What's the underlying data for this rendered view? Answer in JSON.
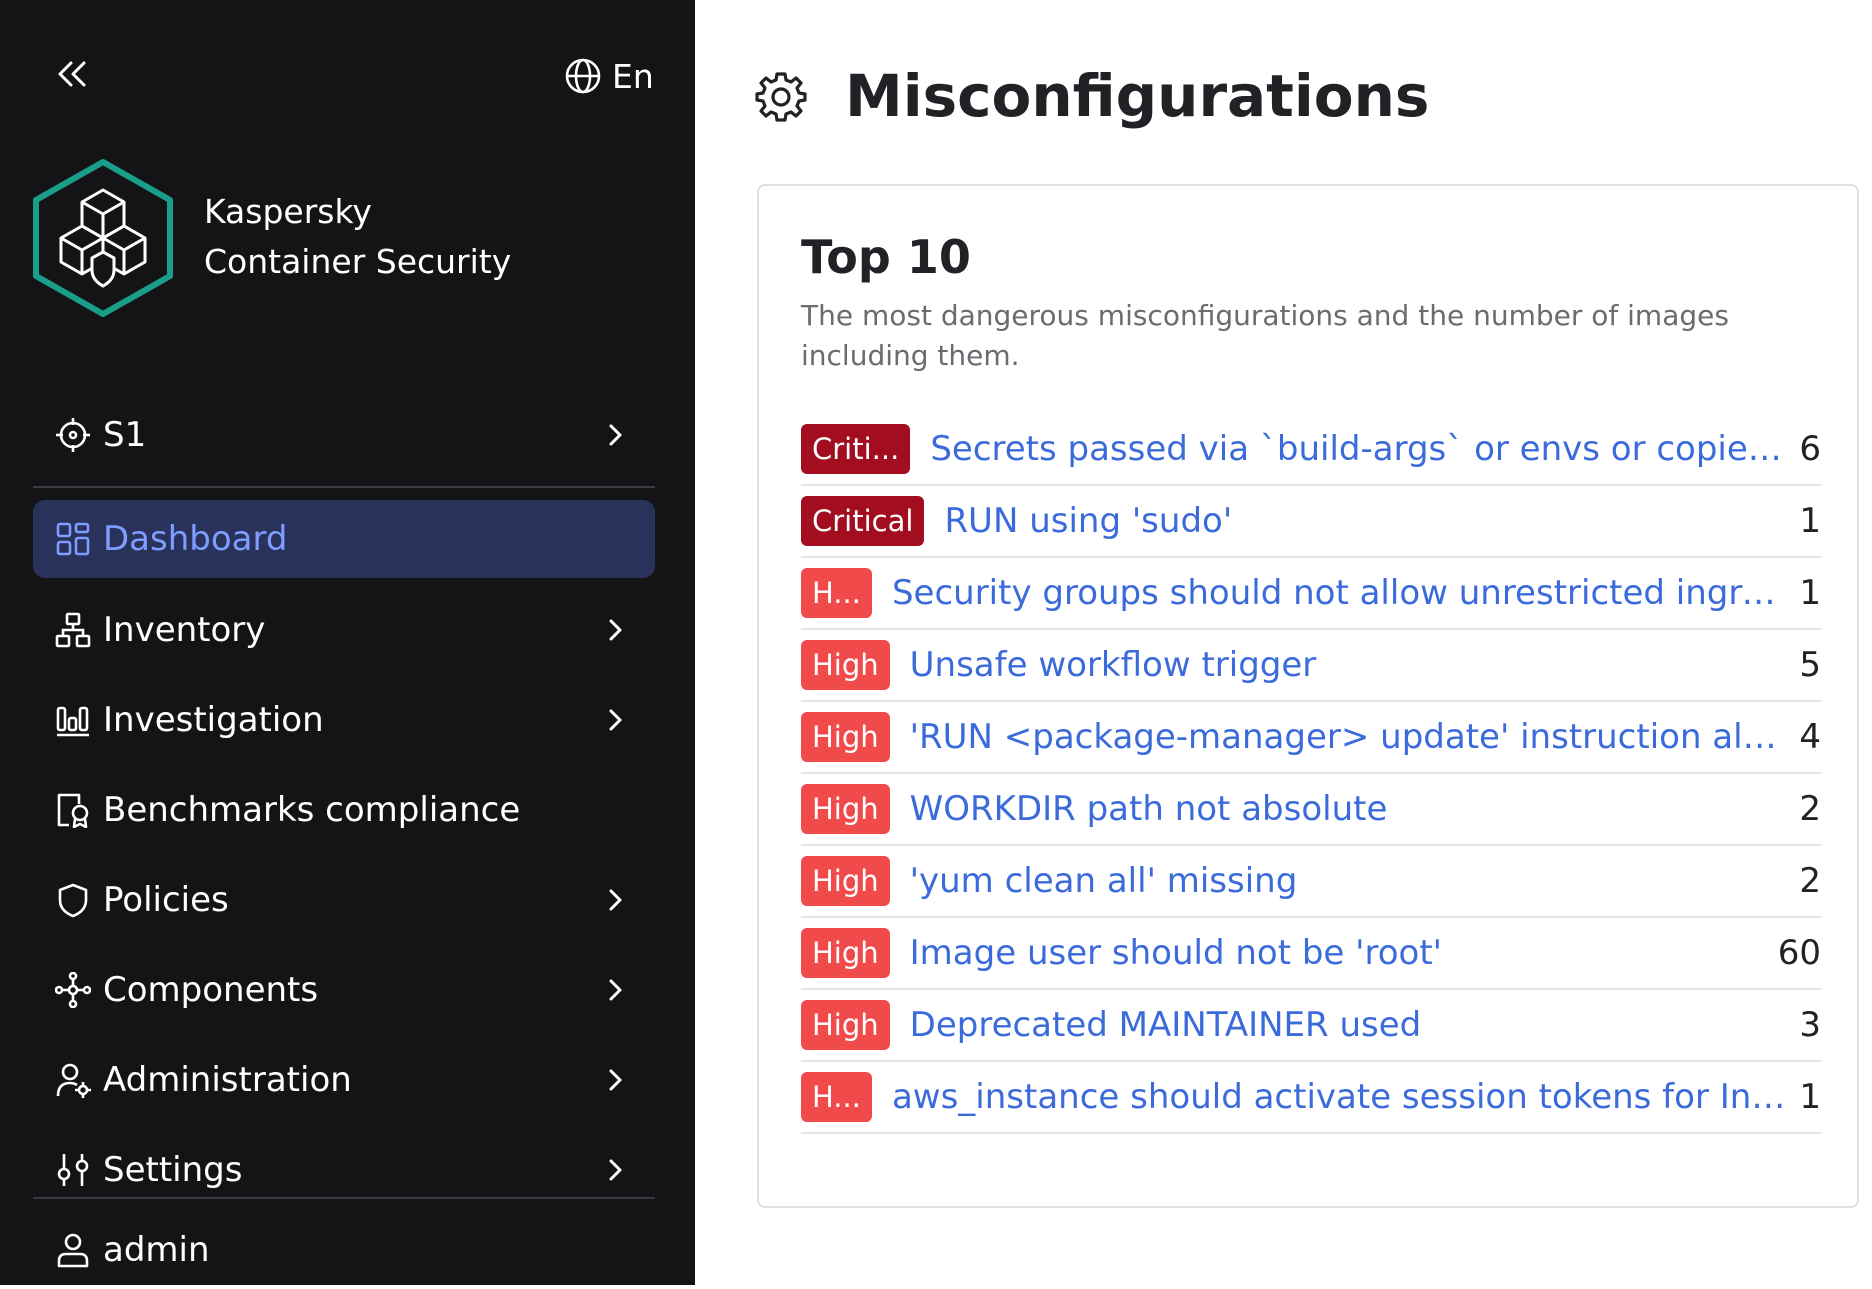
{
  "sidebar": {
    "language": "En",
    "brand_line1": "Kaspersky",
    "brand_line2": "Container Security",
    "scope": "S1",
    "items": [
      {
        "label": "Dashboard",
        "icon": "dashboard-icon",
        "active": true
      },
      {
        "label": "Inventory",
        "icon": "inventory-icon"
      },
      {
        "label": "Investigation",
        "icon": "investigation-icon"
      },
      {
        "label": "Benchmarks compliance",
        "icon": "benchmarks-icon"
      },
      {
        "label": "Policies",
        "icon": "shield-icon"
      },
      {
        "label": "Components",
        "icon": "components-icon"
      },
      {
        "label": "Administration",
        "icon": "administration-icon"
      },
      {
        "label": "Settings",
        "icon": "settings-icon"
      }
    ],
    "user": "admin"
  },
  "main": {
    "title": "Misconfigurations",
    "card": {
      "title": "Top 10",
      "description": "The most dangerous misconfigurations and the number of images including them.",
      "rows": [
        {
          "severity": "Criti...",
          "level": "critical",
          "title": "Secrets passed via `build-args` or envs or copied secr...",
          "count": "6"
        },
        {
          "severity": "Critical",
          "level": "critical",
          "title": "RUN using 'sudo'",
          "count": "1"
        },
        {
          "severity": "H...",
          "level": "high",
          "title": "Security groups should not allow unrestricted ingress to ...",
          "count": "1"
        },
        {
          "severity": "High",
          "level": "high",
          "title": "Unsafe workflow trigger",
          "count": "5"
        },
        {
          "severity": "High",
          "level": "high",
          "title": "'RUN <package-manager> update' instruction alone",
          "count": "4"
        },
        {
          "severity": "High",
          "level": "high",
          "title": "WORKDIR path not absolute",
          "count": "2"
        },
        {
          "severity": "High",
          "level": "high",
          "title": "'yum clean all' missing",
          "count": "2"
        },
        {
          "severity": "High",
          "level": "high",
          "title": "Image user should not be 'root'",
          "count": "60"
        },
        {
          "severity": "High",
          "level": "high",
          "title": "Deprecated MAINTAINER used",
          "count": "3"
        },
        {
          "severity": "H...",
          "level": "high",
          "title": "aws_instance should activate session tokens for Instanc...",
          "count": "1"
        }
      ]
    }
  },
  "colors": {
    "sidebar_bg": "#141417",
    "active_bg": "#28325a",
    "active_fg": "#7f9cff",
    "critical": "#a20d1f",
    "high": "#f04a4a",
    "link": "#3b6bdb",
    "logo_teal": "#1a9e8a"
  }
}
